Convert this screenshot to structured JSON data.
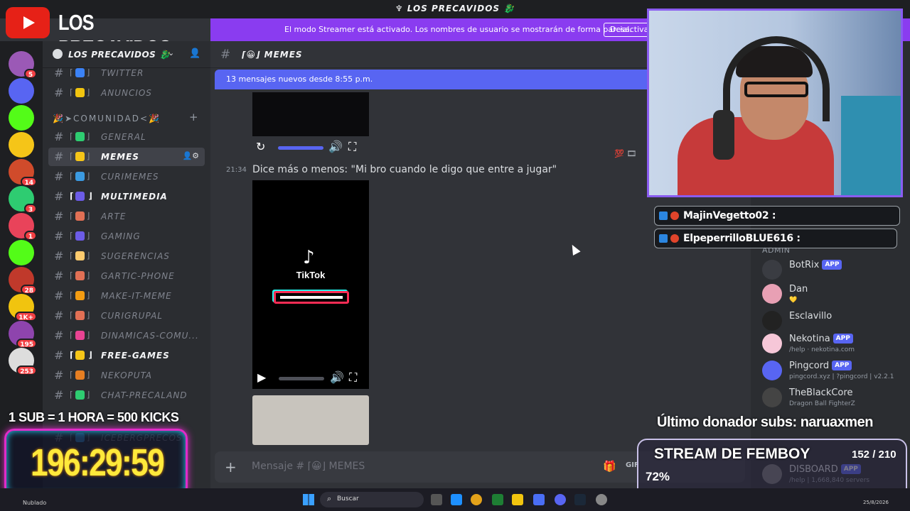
{
  "window": {
    "title": "♆ LOS PRECAVIDOS 🐉"
  },
  "streamer_mode": {
    "message": "El modo Streamer está activado. Los nombres de usuario se mostrarán de forma parcial.",
    "button": "Desactivar"
  },
  "logo": {
    "text": "LOS PRECAVIDOS"
  },
  "rail": {
    "servers": [
      {
        "icon": "party-icon",
        "color": "#9b59b6",
        "badge": "5"
      },
      {
        "icon": "folder-icon",
        "color": "#5865f2",
        "badge": ""
      },
      {
        "icon": "kick-icon",
        "color": "#53fc18",
        "badge": ""
      },
      {
        "icon": "server-icon",
        "color": "#f5c518",
        "badge": ""
      },
      {
        "icon": "server-icon",
        "color": "#d04b2b",
        "badge": "14"
      },
      {
        "icon": "server-icon",
        "color": "#2ecc71",
        "badge": "3"
      },
      {
        "icon": "server-icon",
        "color": "#e9435a",
        "badge": "1"
      },
      {
        "icon": "kick-icon",
        "color": "#53fc18",
        "badge": ""
      },
      {
        "icon": "server-icon",
        "color": "#c0392b",
        "badge": "28"
      },
      {
        "icon": "server-icon",
        "color": "#f1c40f",
        "badge": "1K+"
      },
      {
        "icon": "server-icon",
        "color": "#8e44ad",
        "badge": "195"
      },
      {
        "icon": "server-icon",
        "color": "#dddddd",
        "badge": "253"
      }
    ]
  },
  "sidebar": {
    "server_name": "LOS PRECAVIDOS 🐉",
    "category": "🎉➤COMUNIDAD<🎉",
    "channels": [
      {
        "label": "TWITTER",
        "emoji_color": "#3b82f6",
        "state": "normal"
      },
      {
        "label": "ANUNCIOS",
        "emoji_color": "#f1c40f",
        "state": "normal"
      },
      {
        "label": "GENERAL",
        "emoji_color": "#2ecc71",
        "state": "normal"
      },
      {
        "label": "MEMES",
        "emoji_color": "#f5c518",
        "state": "active"
      },
      {
        "label": "CURIMEMES",
        "emoji_color": "#3b9ae1",
        "state": "normal"
      },
      {
        "label": "MULTIMEDIA",
        "emoji_color": "#6c5ce7",
        "state": "unread"
      },
      {
        "label": "ARTE",
        "emoji_color": "#e17055",
        "state": "normal"
      },
      {
        "label": "GAMING",
        "emoji_color": "#6c5ce7",
        "state": "normal"
      },
      {
        "label": "SUGERENCIAS",
        "emoji_color": "#fdcb6e",
        "state": "normal"
      },
      {
        "label": "GARTIC-PHONE",
        "emoji_color": "#e17055",
        "state": "normal"
      },
      {
        "label": "MAKE-IT-MEME",
        "emoji_color": "#f39c12",
        "state": "normal"
      },
      {
        "label": "CURIGRUPAL",
        "emoji_color": "#e17055",
        "state": "normal"
      },
      {
        "label": "DINAMICAS-COMU...",
        "emoji_color": "#e84393",
        "state": "normal"
      },
      {
        "label": "FREE-GAMES",
        "emoji_color": "#f5c518",
        "state": "unread"
      },
      {
        "label": "NEKOPUTA",
        "emoji_color": "#e67e22",
        "state": "normal"
      },
      {
        "label": "CHAT-PRECALAND",
        "emoji_color": "#2ecc71",
        "state": "normal"
      },
      {
        "label": "ICEBERGPRECOS",
        "emoji_color": "#3498db",
        "state": "normal"
      }
    ]
  },
  "chat": {
    "channel_name": "⌈😀⌋ MEMES",
    "new_messages": "13 mensajes nuevos desde 8:55 p.m.",
    "message": {
      "timestamp": "21:34",
      "text": "Dice más o menos: \"Mi bro cuando le digo que entre a jugar\""
    },
    "video_brand": "TikTok",
    "reactions": "💯 🎞",
    "composer_placeholder": "Mensaje # ⌈😀⌋ MEMES",
    "composer_gif": "GIF"
  },
  "members": {
    "group": "ADMIN",
    "list": [
      {
        "name": "BotRix",
        "tag": "APP",
        "sub": "",
        "color": "#3a3c42"
      },
      {
        "name": "Dan",
        "tag": "",
        "sub": "💛",
        "color": "#e8a0b4"
      },
      {
        "name": "Esclavillo",
        "tag": "",
        "sub": "",
        "color": "#222"
      },
      {
        "name": "Nekotina",
        "tag": "APP",
        "sub": "/help · nekotina.com",
        "color": "#f6c7d8"
      },
      {
        "name": "Pingcord",
        "tag": "APP",
        "sub": "pingcord.xyz | ?pingcord | v2.2.1",
        "color": "#5865f2"
      },
      {
        "name": "TheBlackCore",
        "tag": "",
        "sub": "Dragon Ball FighterZ",
        "color": "#444"
      },
      {
        "name": "DISBOARD",
        "tag": "APP",
        "sub": "/help | 1,668,840 servers",
        "color": "#777"
      }
    ]
  },
  "overlay": {
    "chat": [
      {
        "text": "MajinVegetto02 :"
      },
      {
        "text": "ElpeperrilloBLUE616 :"
      }
    ],
    "donor": "Último donador subs: naruaxmen",
    "goal": {
      "title": "STREAM DE FEMBOY",
      "count": "152 / 210",
      "percent_label": "72%",
      "progress": 0.72
    },
    "subtimer_title": "1 SUB = 1 HORA = 500 KICKS",
    "timer": "196:29:59"
  },
  "taskbar": {
    "weather": "Nublado",
    "search": "Buscar",
    "date": "25/8/2026"
  }
}
